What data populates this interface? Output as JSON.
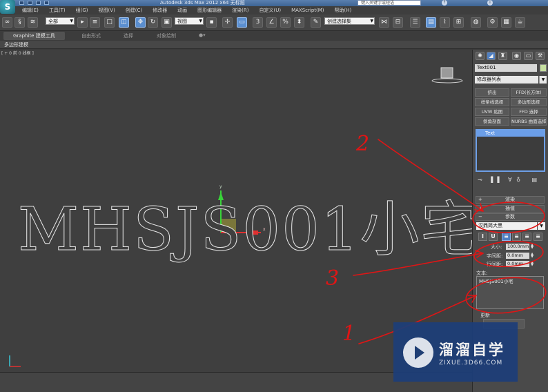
{
  "titlebar": {
    "title": "Autodesk 3ds Max 2012 x64     无标题",
    "search_placeholder": "键入关键字或短语"
  },
  "app_logo": "S",
  "menubar": {
    "items": [
      "编辑(E)",
      "工具(T)",
      "组(G)",
      "视图(V)",
      "创建(C)",
      "修改器",
      "动画",
      "图形编辑器",
      "渲染(R)",
      "自定义(U)",
      "MAXScript(M)",
      "帮助(H)"
    ]
  },
  "toolbar": {
    "selection_filter": "全部",
    "coord_system": "视图",
    "named_selection": "创建选择集",
    "snap_label": "3",
    "percent_snap": "%"
  },
  "ribbon": {
    "tabs": [
      "Graphite 建模工具",
      "自由形式",
      "选择",
      "对象绘制"
    ],
    "active_panel": "多边形建模"
  },
  "viewport": {
    "label": "[ + 0 前 0 线框 ]",
    "text_object": "MHSJS001小宅",
    "axis_y": "y",
    "axis_x": "x"
  },
  "command_panel": {
    "object_name": "Text001",
    "modifier_list": "修改器列表",
    "modifier_buttons": [
      "挤出",
      "FFD(长方体)",
      "样条线选择",
      "多边形选择",
      "UVW 贴图",
      "FFD 选择",
      "倒角剖面",
      "NURBS 曲面选择"
    ],
    "stack_item": "Text",
    "rollouts": {
      "render": "渲染",
      "interp": "插值",
      "params": "参数"
    },
    "font": "汉鼎简大黑",
    "size_label": "大小:",
    "size_value": "100.0mm",
    "kerning_label": "字间距:",
    "kerning_value": "0.0mm",
    "leading_label": "行间距:",
    "leading_value": "0.0mm",
    "text_label": "文本:",
    "text_value": "MHSJS001小宅",
    "update_label": "更新"
  },
  "annotations": {
    "n1": "1",
    "n2": "2",
    "n3": "3",
    "stroke_color": "#e01515"
  },
  "watermark": {
    "title": "溜溜自学",
    "url": "ZIXUE.3D66.COM"
  }
}
